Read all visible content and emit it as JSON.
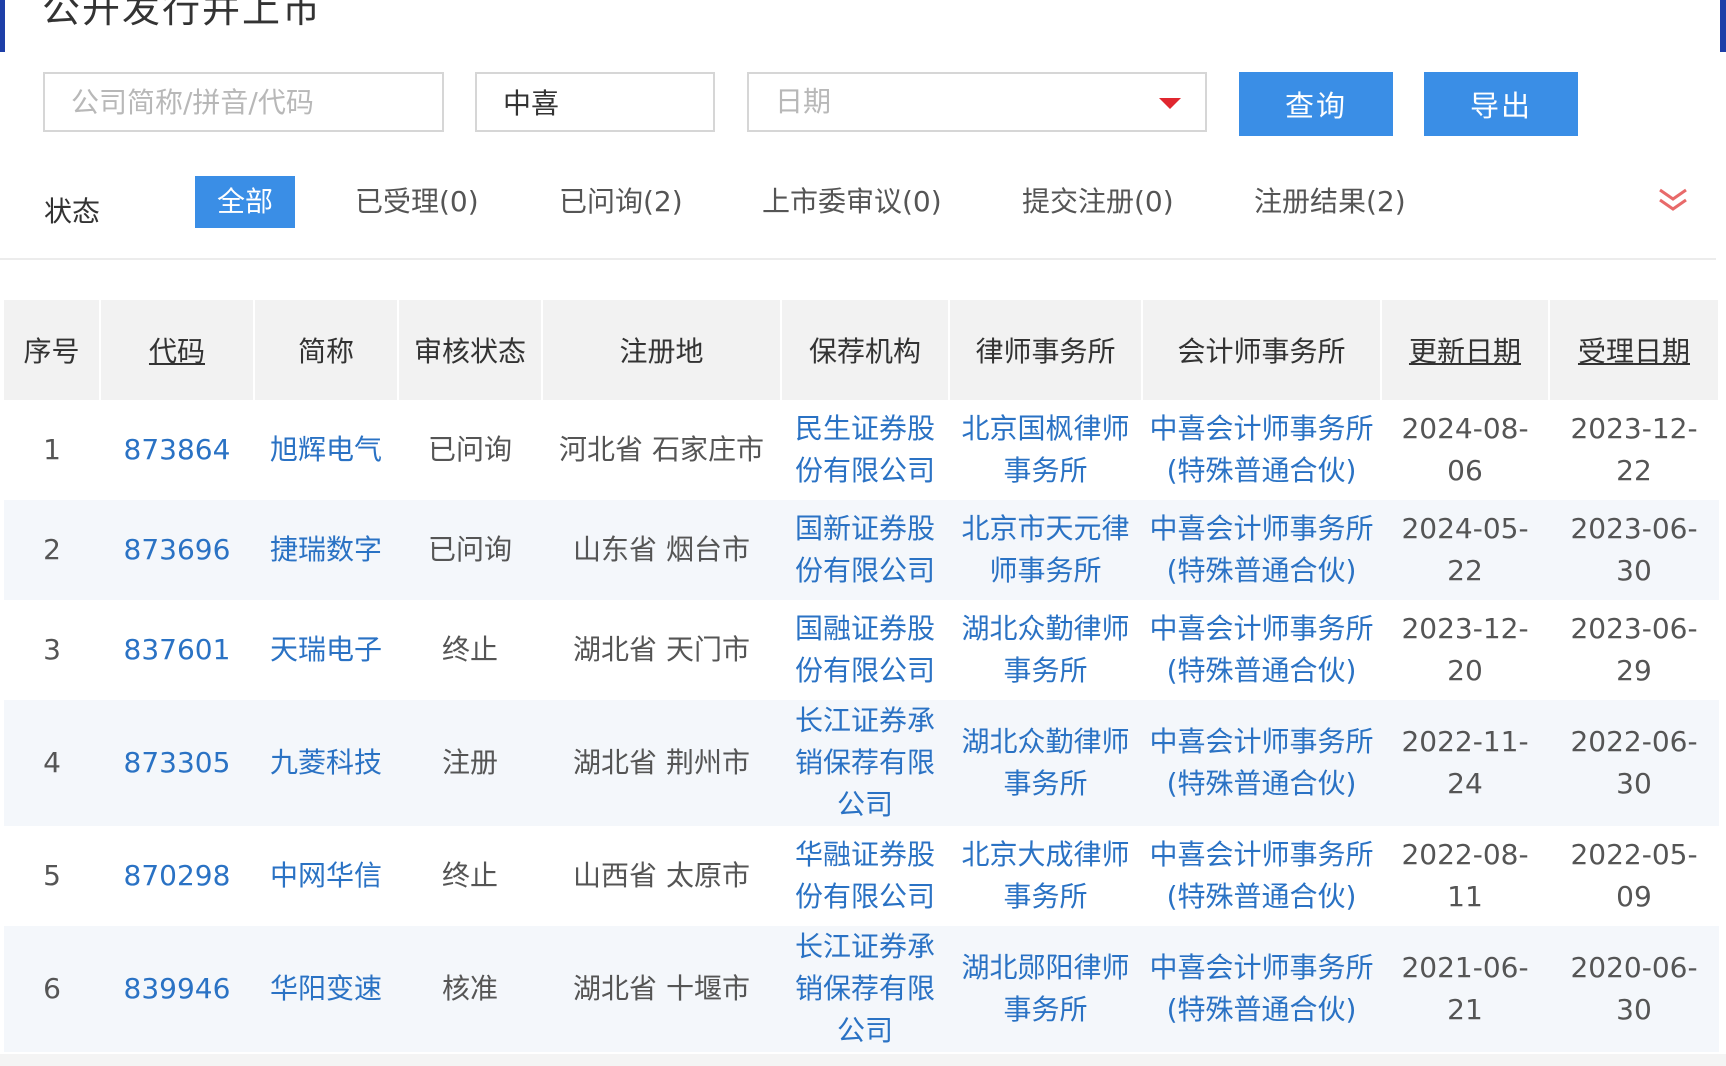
{
  "page": {
    "title": "公开发行并上市"
  },
  "filters": {
    "search_placeholder": "公司简称/拼音/代码",
    "firm_value": "中喜",
    "date_placeholder": "日期",
    "query_label": "查询",
    "export_label": "导出"
  },
  "status": {
    "label": "状态",
    "tabs": [
      {
        "label": "全部"
      },
      {
        "label": "已受理(0)"
      },
      {
        "label": "已问询(2)"
      },
      {
        "label": "上市委审议(0)"
      },
      {
        "label": "提交注册(0)"
      },
      {
        "label": "注册结果(2)"
      }
    ]
  },
  "colors": {
    "accent": "#3a8ee6",
    "link": "#2a72c4",
    "caret": "#e0262f"
  },
  "icons": {
    "expand": "double-chevron-down-icon",
    "dropdown": "caret-down-icon"
  },
  "table": {
    "headers": [
      "序号",
      "代码",
      "简称",
      "审核状态",
      "注册地",
      "保荐机构",
      "律师事务所",
      "会计师事务所",
      "更新日期",
      "受理日期"
    ],
    "rows": [
      {
        "no": "1",
        "code": "873864",
        "name": "旭辉电气",
        "status": "已问询",
        "region": "河北省 石家庄市",
        "sponsor": "民生证券股份有限公司",
        "law": "北京国枫律师事务所",
        "acct": "中喜会计师事务所(特殊普通合伙)",
        "updated": "2024-08-06",
        "accepted": "2023-12-22"
      },
      {
        "no": "2",
        "code": "873696",
        "name": "捷瑞数字",
        "status": "已问询",
        "region": "山东省 烟台市",
        "sponsor": "国新证券股份有限公司",
        "law": "北京市天元律师事务所",
        "acct": "中喜会计师事务所(特殊普通合伙)",
        "updated": "2024-05-22",
        "accepted": "2023-06-30"
      },
      {
        "no": "3",
        "code": "837601",
        "name": "天瑞电子",
        "status": "终止",
        "region": "湖北省 天门市",
        "sponsor": "国融证券股份有限公司",
        "law": "湖北众勤律师事务所",
        "acct": "中喜会计师事务所(特殊普通合伙)",
        "updated": "2023-12-20",
        "accepted": "2023-06-29"
      },
      {
        "no": "4",
        "code": "873305",
        "name": "九菱科技",
        "status": "注册",
        "region": "湖北省 荆州市",
        "sponsor": "长江证券承销保荐有限公司",
        "law": "湖北众勤律师事务所",
        "acct": "中喜会计师事务所(特殊普通合伙)",
        "updated": "2022-11-24",
        "accepted": "2022-06-30"
      },
      {
        "no": "5",
        "code": "870298",
        "name": "中网华信",
        "status": "终止",
        "region": "山西省 太原市",
        "sponsor": "华融证券股份有限公司",
        "law": "北京大成律师事务所",
        "acct": "中喜会计师事务所(特殊普通合伙)",
        "updated": "2022-08-11",
        "accepted": "2022-05-09"
      },
      {
        "no": "6",
        "code": "839946",
        "name": "华阳变速",
        "status": "核准",
        "region": "湖北省 十堰市",
        "sponsor": "长江证券承销保荐有限公司",
        "law": "湖北郧阳律师事务所",
        "acct": "中喜会计师事务所(特殊普通合伙)",
        "updated": "2021-06-21",
        "accepted": "2020-06-30"
      }
    ]
  }
}
